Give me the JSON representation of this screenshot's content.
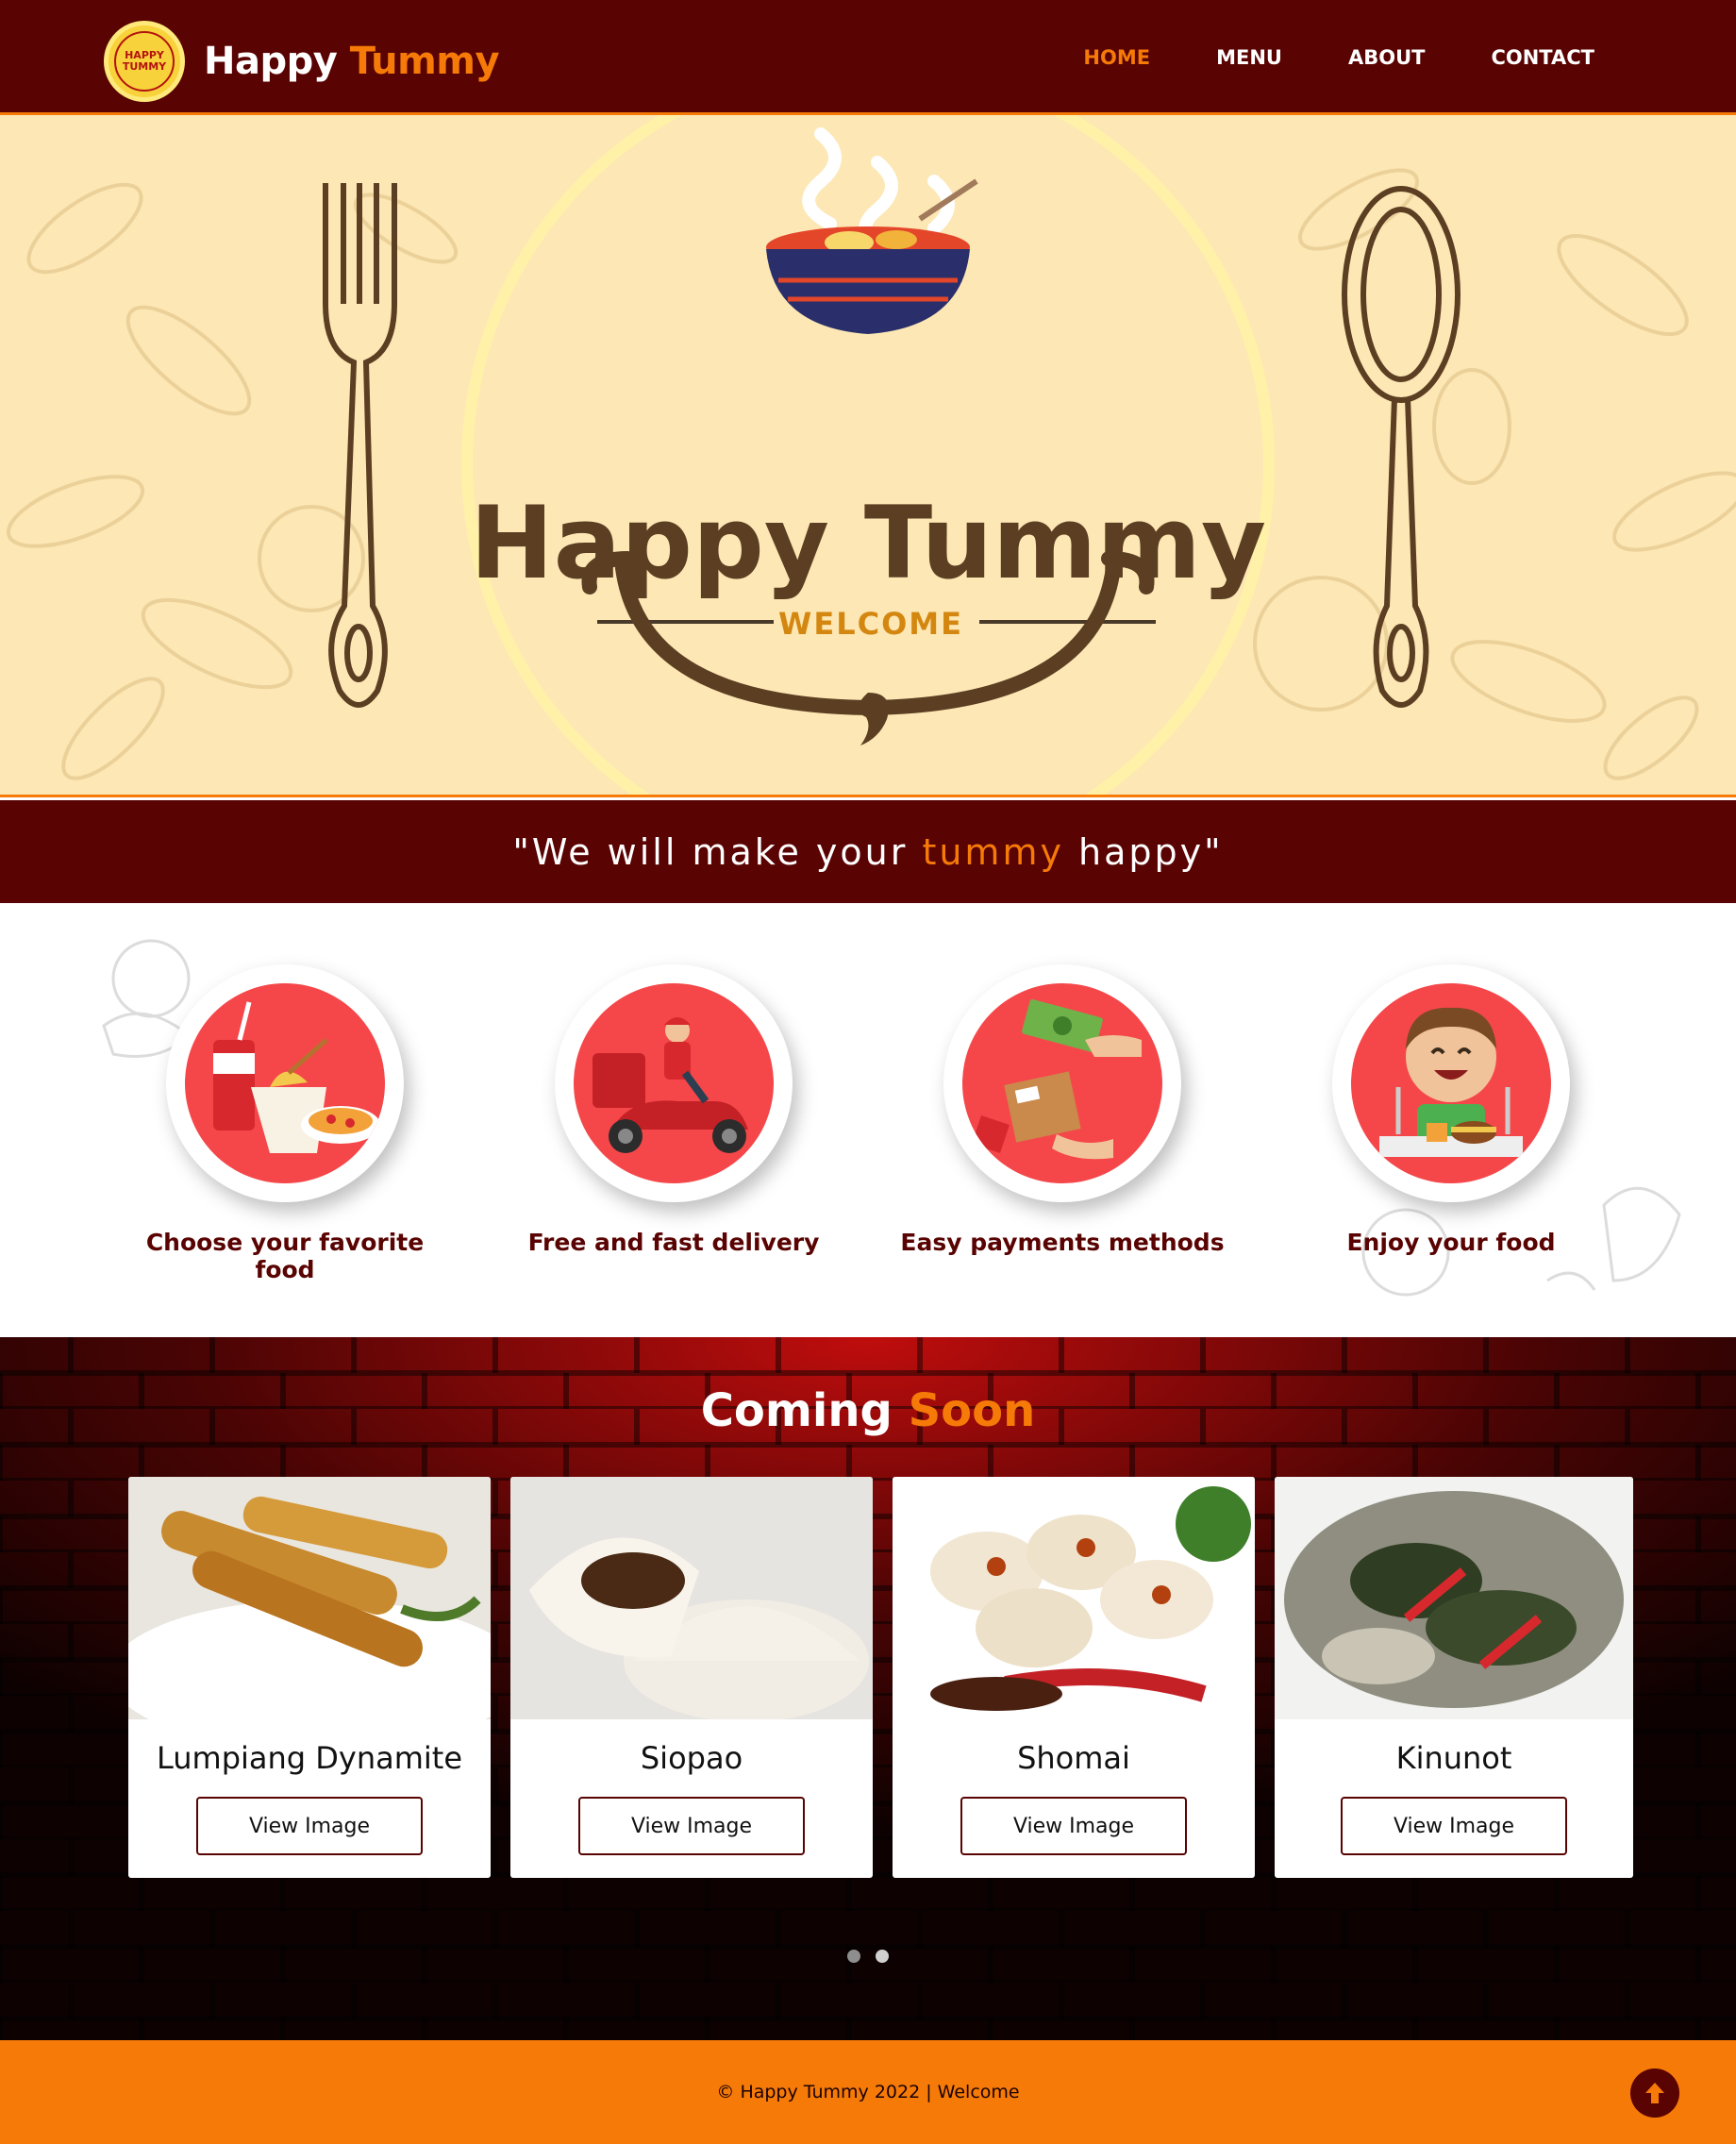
{
  "navbar": {
    "logo_text_top": "HAPPY",
    "logo_text_bottom": "TUMMY",
    "brand_first": "Happy",
    "brand_second": "Tummy",
    "links": [
      {
        "label": "HOME",
        "active": true
      },
      {
        "label": "MENU",
        "active": false
      },
      {
        "label": "ABOUT",
        "active": false
      },
      {
        "label": "CONTACT",
        "active": false
      }
    ]
  },
  "hero": {
    "title": "Happy Tummy",
    "subtitle": "WELCOME"
  },
  "tagline": {
    "before": "\"We will make your ",
    "accent": "tummy",
    "after": " happy\""
  },
  "features": [
    {
      "label": "Choose your favorite food",
      "icon": "food-combo-icon"
    },
    {
      "label": "Free and fast delivery",
      "icon": "delivery-scooter-icon"
    },
    {
      "label": "Easy payments methods",
      "icon": "payment-exchange-icon"
    },
    {
      "label": "Enjoy your food",
      "icon": "happy-eater-icon"
    }
  ],
  "coming_soon": {
    "title_first": "Coming",
    "title_second": "Soon",
    "cards": [
      {
        "name": "Lumpiang Dynamite",
        "button": "View Image"
      },
      {
        "name": "Siopao",
        "button": "View Image"
      },
      {
        "name": "Shomai",
        "button": "View Image"
      },
      {
        "name": "Kinunot",
        "button": "View Image"
      }
    ],
    "carousel_pages": 2,
    "carousel_active": 1
  },
  "footer": {
    "text": "© Happy Tummy 2022 | Welcome"
  },
  "colors": {
    "maroon": "#590302",
    "orange": "#f67a08",
    "cream": "#fde7b4",
    "feature_red": "#f5474a"
  }
}
